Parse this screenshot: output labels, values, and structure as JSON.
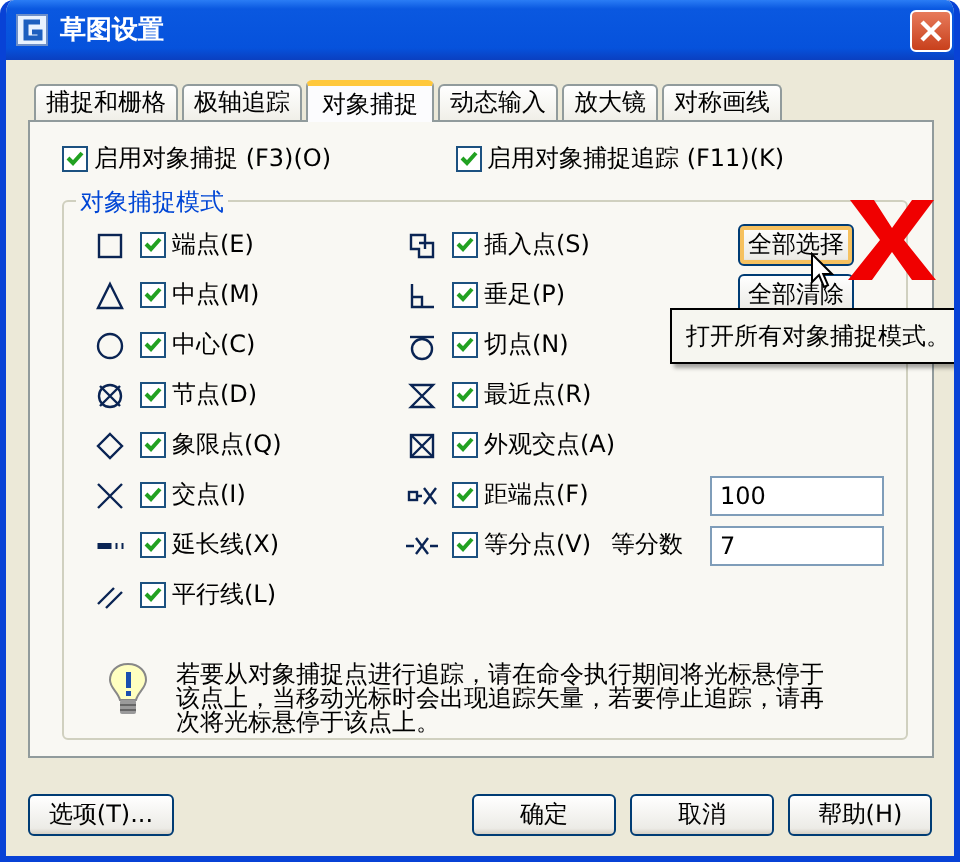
{
  "window": {
    "title": "草图设置"
  },
  "tabs": [
    {
      "label": "捕捉和栅格",
      "selected": false
    },
    {
      "label": "极轴追踪",
      "selected": false
    },
    {
      "label": "对象捕捉",
      "selected": true
    },
    {
      "label": "动态输入",
      "selected": false
    },
    {
      "label": "放大镜",
      "selected": false
    },
    {
      "label": "对称画线",
      "selected": false
    }
  ],
  "options": [
    {
      "label": "启用对象捕捉 (F3)(O)",
      "checked": true
    },
    {
      "label": "启用对象捕捉追踪 (F11)(K)",
      "checked": true
    }
  ],
  "modes_group": {
    "title": "对象捕捉模式",
    "modes": [
      {
        "kind": "endpoint",
        "label": "端点(E)",
        "checked": true
      },
      {
        "kind": "insert",
        "label": "插入点(S)",
        "checked": true
      },
      {
        "kind": "midpoint",
        "label": "中点(M)",
        "checked": true
      },
      {
        "kind": "perpendicular",
        "label": "垂足(P)",
        "checked": true
      },
      {
        "kind": "center",
        "label": "中心(C)",
        "checked": true
      },
      {
        "kind": "tangent",
        "label": "切点(N)",
        "checked": true
      },
      {
        "kind": "node",
        "label": "节点(D)",
        "checked": true
      },
      {
        "kind": "nearest",
        "label": "最近点(R)",
        "checked": true
      },
      {
        "kind": "quadrant",
        "label": "象限点(Q)",
        "checked": true
      },
      {
        "kind": "apparent",
        "label": "外观交点(A)",
        "checked": true
      },
      {
        "kind": "intersection",
        "label": "交点(I)",
        "checked": true
      },
      {
        "kind": "from",
        "label": "距端点(F)",
        "checked": true,
        "value": "100"
      },
      {
        "kind": "extension",
        "label": "延长线(X)",
        "checked": true
      },
      {
        "kind": "divide",
        "label": "等分点(V)",
        "checked": true,
        "extra_label": "等分数",
        "value": "7"
      },
      {
        "kind": "parallel",
        "label": "平行线(L)",
        "checked": true
      }
    ],
    "buttons": [
      "全部选择",
      "全部清除"
    ]
  },
  "tooltip": "打开所有对象捕捉模式。",
  "hint": "若要从对象捕捉点进行追踪，请在命令执行期间将光标悬停于该点上，当移动光标时会出现追踪矢量，若要停止追踪，请再次将光标悬停于该点上。",
  "footer": {
    "options_button": "选项(T)...",
    "buttons": [
      "确定",
      "取消",
      "帮助(H)"
    ]
  }
}
